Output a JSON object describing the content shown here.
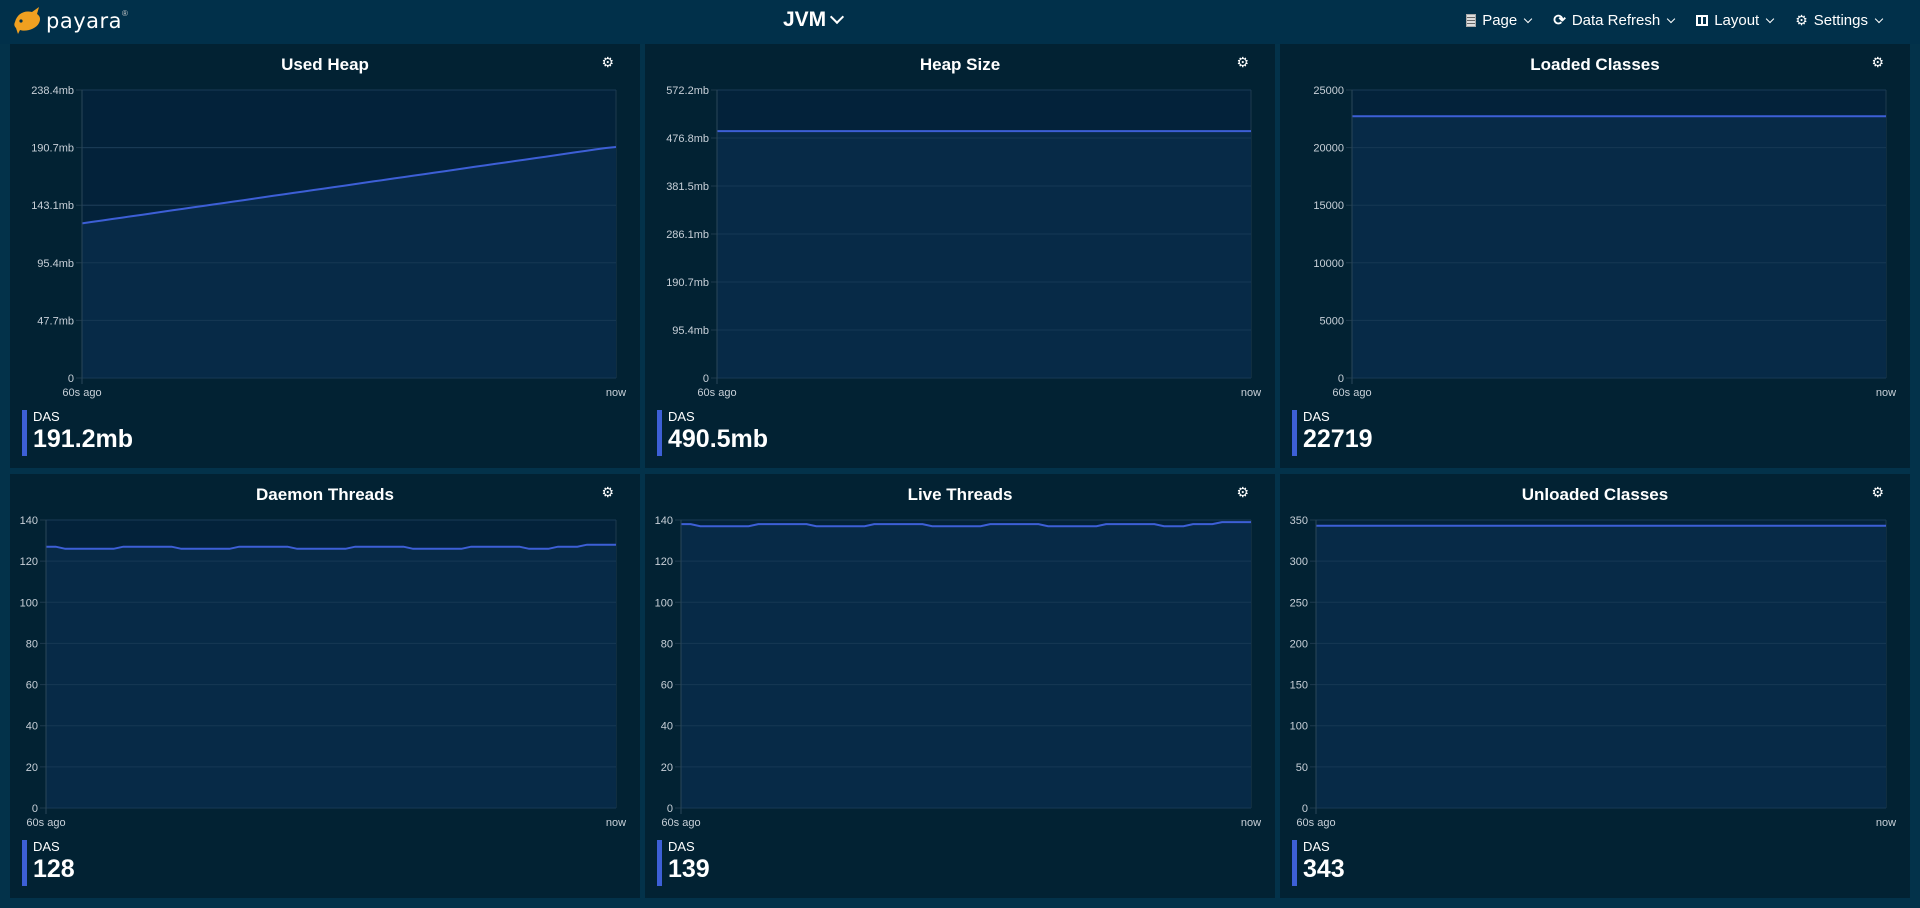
{
  "header": {
    "logo_text": "payara",
    "logo_reg": "®",
    "page_title": "JVM",
    "menu": [
      {
        "label": "Page",
        "icon": "page-icon"
      },
      {
        "label": "Data Refresh",
        "icon": "refresh-icon"
      },
      {
        "label": "Layout",
        "icon": "layout-icon"
      },
      {
        "label": "Settings",
        "icon": "gear-icon"
      }
    ]
  },
  "colors": {
    "series_line": "#3d5fd6",
    "legend_bar": "#3d5fd6"
  },
  "panels": [
    {
      "title": "Used Heap",
      "legend_name": "DAS",
      "legend_value": "191.2mb"
    },
    {
      "title": "Heap Size",
      "legend_name": "DAS",
      "legend_value": "490.5mb"
    },
    {
      "title": "Loaded Classes",
      "legend_name": "DAS",
      "legend_value": "22719"
    },
    {
      "title": "Daemon Threads",
      "legend_name": "DAS",
      "legend_value": "128"
    },
    {
      "title": "Live Threads",
      "legend_name": "DAS",
      "legend_value": "139"
    },
    {
      "title": "Unloaded Classes",
      "legend_name": "DAS",
      "legend_value": "343"
    }
  ],
  "chart_data": [
    {
      "type": "area",
      "title": "Used Heap",
      "xlabel": "",
      "ylabel": "",
      "x_tick_labels": [
        "60s ago",
        "now"
      ],
      "y_tick_labels": [
        "0",
        "47.7mb",
        "95.4mb",
        "143.1mb",
        "190.7mb",
        "238.4mb"
      ],
      "ylim": [
        0,
        238.4
      ],
      "unit": "mb",
      "grid": true,
      "series": [
        {
          "name": "DAS",
          "values": [
            128.0,
            129.2,
            130.4,
            131.6,
            132.8,
            134.0,
            135.2,
            136.4,
            137.6,
            138.8,
            140.0,
            141.2,
            142.4,
            143.6,
            144.8,
            146.0,
            147.2,
            148.4,
            149.6,
            150.8,
            152.0,
            153.2,
            154.4,
            155.6,
            156.8,
            158.0,
            159.2,
            160.4,
            161.6,
            162.8,
            164.0,
            165.2,
            166.4,
            167.6,
            168.8,
            170.0,
            171.2,
            172.4,
            173.6,
            174.8,
            176.0,
            177.2,
            178.4,
            179.6,
            180.8,
            182.0,
            183.2,
            184.4,
            185.6,
            186.8,
            188.0,
            189.2,
            190.4,
            191.2
          ]
        }
      ]
    },
    {
      "type": "area",
      "title": "Heap Size",
      "xlabel": "",
      "ylabel": "",
      "x_tick_labels": [
        "60s ago",
        "now"
      ],
      "y_tick_labels": [
        "0",
        "95.4mb",
        "190.7mb",
        "286.1mb",
        "381.5mb",
        "476.8mb",
        "572.2mb"
      ],
      "ylim": [
        0,
        572.2
      ],
      "unit": "mb",
      "grid": true,
      "series": [
        {
          "name": "DAS",
          "values": [
            490.5,
            490.5,
            490.5,
            490.5,
            490.5,
            490.5,
            490.5,
            490.5,
            490.5,
            490.5
          ]
        }
      ]
    },
    {
      "type": "area",
      "title": "Loaded Classes",
      "xlabel": "",
      "ylabel": "",
      "x_tick_labels": [
        "60s ago",
        "now"
      ],
      "y_tick_labels": [
        "0",
        "5000",
        "10000",
        "15000",
        "20000",
        "25000"
      ],
      "ylim": [
        0,
        25000
      ],
      "grid": true,
      "series": [
        {
          "name": "DAS",
          "values": [
            22719,
            22719,
            22719,
            22719,
            22719,
            22719,
            22719,
            22719,
            22719,
            22719
          ]
        }
      ]
    },
    {
      "type": "area",
      "title": "Daemon Threads",
      "xlabel": "",
      "ylabel": "",
      "x_tick_labels": [
        "60s ago",
        "now"
      ],
      "y_tick_labels": [
        "0",
        "20",
        "40",
        "60",
        "80",
        "100",
        "120",
        "140"
      ],
      "ylim": [
        0,
        140
      ],
      "grid": true,
      "series": [
        {
          "name": "DAS",
          "values": [
            127,
            127,
            126,
            126,
            126,
            126,
            126,
            126,
            127,
            127,
            127,
            127,
            127,
            127,
            126,
            126,
            126,
            126,
            126,
            126,
            127,
            127,
            127,
            127,
            127,
            127,
            126,
            126,
            126,
            126,
            126,
            126,
            127,
            127,
            127,
            127,
            127,
            127,
            126,
            126,
            126,
            126,
            126,
            126,
            127,
            127,
            127,
            127,
            127,
            127,
            126,
            126,
            126,
            127,
            127,
            127,
            128,
            128,
            128,
            128
          ]
        }
      ]
    },
    {
      "type": "area",
      "title": "Live Threads",
      "xlabel": "",
      "ylabel": "",
      "x_tick_labels": [
        "60s ago",
        "now"
      ],
      "y_tick_labels": [
        "0",
        "20",
        "40",
        "60",
        "80",
        "100",
        "120",
        "140"
      ],
      "ylim": [
        0,
        140
      ],
      "grid": true,
      "series": [
        {
          "name": "DAS",
          "values": [
            138,
            138,
            137,
            137,
            137,
            137,
            137,
            137,
            138,
            138,
            138,
            138,
            138,
            138,
            137,
            137,
            137,
            137,
            137,
            137,
            138,
            138,
            138,
            138,
            138,
            138,
            137,
            137,
            137,
            137,
            137,
            137,
            138,
            138,
            138,
            138,
            138,
            138,
            137,
            137,
            137,
            137,
            137,
            137,
            138,
            138,
            138,
            138,
            138,
            138,
            137,
            137,
            137,
            138,
            138,
            138,
            139,
            139,
            139,
            139
          ]
        }
      ]
    },
    {
      "type": "area",
      "title": "Unloaded Classes",
      "xlabel": "",
      "ylabel": "",
      "x_tick_labels": [
        "60s ago",
        "now"
      ],
      "y_tick_labels": [
        "0",
        "50",
        "100",
        "150",
        "200",
        "250",
        "300",
        "350"
      ],
      "ylim": [
        0,
        350
      ],
      "grid": true,
      "series": [
        {
          "name": "DAS",
          "values": [
            343,
            343,
            343,
            343,
            343,
            343,
            343,
            343,
            343,
            343
          ]
        }
      ]
    }
  ]
}
